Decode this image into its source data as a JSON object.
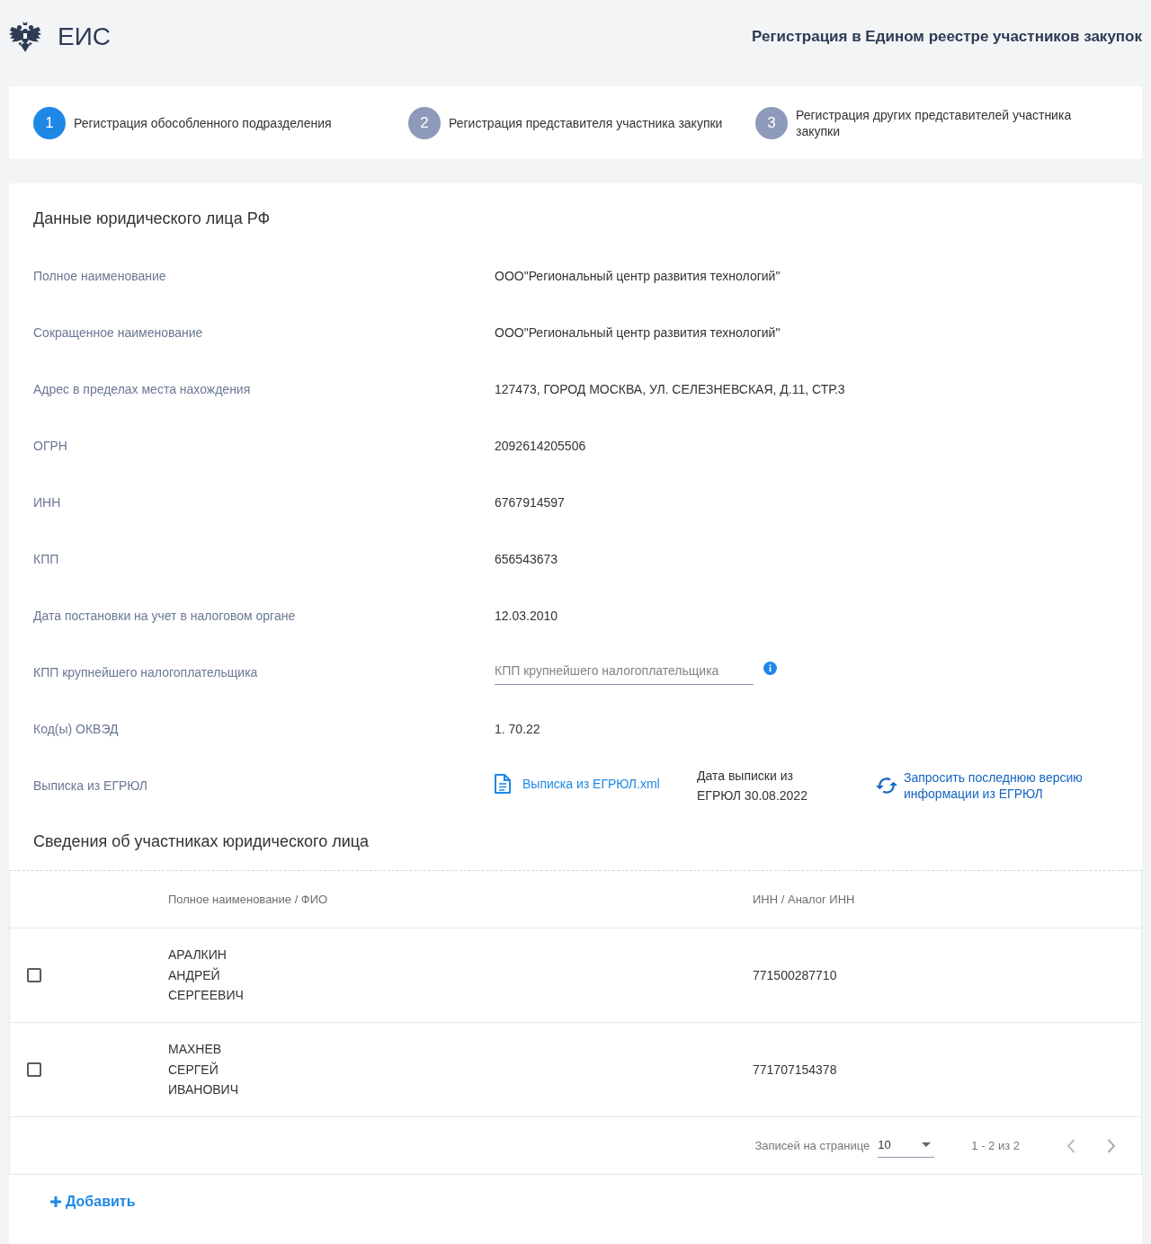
{
  "header": {
    "logo_text": "ЕИС",
    "title": "Регистрация в Едином реестре участников закупок"
  },
  "steps": [
    {
      "number": "1",
      "label": "Регистрация обособленного подразделения",
      "selected": true
    },
    {
      "number": "2",
      "label": "Регистрация представителя участника закупки",
      "selected": false
    },
    {
      "number": "3",
      "label": "Регистрация других представителей участника закупки",
      "selected": false
    }
  ],
  "legal_entity": {
    "title": "Данные юридического лица РФ",
    "fields": [
      {
        "kind": "text",
        "label": "Полное наименование",
        "value": "ООО\"Региональный центр развития технологий\""
      },
      {
        "kind": "text",
        "label": "Сокращенное наименование",
        "value": "ООО\"Региональный центр развития технологий\""
      },
      {
        "kind": "text",
        "label": "Адрес в пределах места нахождения",
        "value": "127473, ГОРОД МОСКВА, УЛ. СЕЛЕЗНЕВСКАЯ, Д.11, СТР.3"
      },
      {
        "kind": "text",
        "label": "ОГРН",
        "value": "2092614205506"
      },
      {
        "kind": "text",
        "label": "ИНН",
        "value": "6767914597"
      },
      {
        "kind": "text",
        "label": "КПП",
        "value": "656543673"
      },
      {
        "kind": "text",
        "label": "Дата постановки на учет в налоговом органе",
        "value": "12.03.2010"
      },
      {
        "kind": "input",
        "label": "КПП крупнейшего налогоплательщика",
        "placeholder": "КПП крупнейшего налогоплательщика"
      },
      {
        "kind": "text",
        "label": "Код(ы) ОКВЭД",
        "value": "1. 70.22"
      },
      {
        "kind": "extract",
        "label": "Выписка из ЕГРЮЛ",
        "file_link": "Выписка из ЕГРЮЛ.xml",
        "date_text": "Дата выписки из ЕГРЮЛ 30.08.2022",
        "refresh_link": "Запросить последнюю версию информации из ЕГРЮЛ"
      }
    ]
  },
  "participants": {
    "title": "Сведения об участниках юридического лица",
    "columns": [
      "Полное наименование / ФИО",
      "ИНН / Аналог ИНН"
    ],
    "rows": [
      {
        "checked": false,
        "name": "АРАЛКИН АНДРЕЙ СЕРГЕЕВИЧ",
        "inn": "771500287710"
      },
      {
        "checked": false,
        "name": "МАХНЕВ СЕРГЕЙ ИВАНОВИЧ",
        "inn": "771707154378"
      }
    ],
    "pagination": {
      "rows_per_page_label": "Записей на странице",
      "rows_per_page": "10",
      "range": "1 - 2 из 2"
    },
    "add_button": "Добавить"
  }
}
